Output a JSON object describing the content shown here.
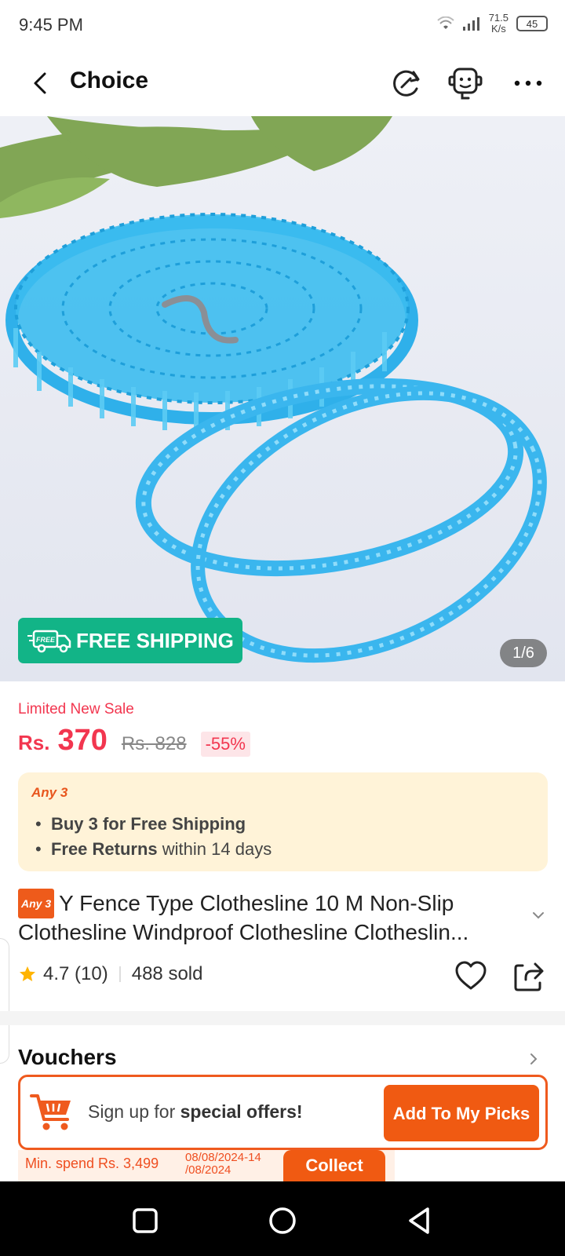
{
  "status_bar": {
    "time": "9:45 PM",
    "net_speed_value": "71.5",
    "net_speed_unit": "K/s",
    "battery": "45"
  },
  "header": {
    "title": "Choice",
    "icons": [
      "back-arrow-icon",
      "refresh-icon",
      "support-bot-icon",
      "more-icon"
    ]
  },
  "gallery": {
    "badge_text": "FREE SHIPPING",
    "badge_icon_text": "FREE",
    "counter": "1/6"
  },
  "price": {
    "sale_label": "Limited New Sale",
    "currency": "Rs.",
    "current": "370",
    "original": "Rs. 828",
    "discount": "-55%"
  },
  "promo": {
    "tag": "Any 3",
    "line1_bold": "Buy 3 for  Free Shipping",
    "line2_bold": "Free Returns",
    "line2_rest": "within 14 days"
  },
  "product": {
    "badge": "Any 3",
    "title_line1": "Y Fence Type Clothesline 10 M Non-Slip",
    "title_line2": "Clothesline Windproof Clothesline Clotheslin..."
  },
  "stats": {
    "rating": "4.7",
    "reviews": "(10)",
    "sold": "488 sold"
  },
  "vouchers": {
    "title": "Vouchers",
    "signup_prefix": "Sign up for",
    "signup_bold": "special offers!",
    "picks_button": "Add To My Picks",
    "min_spend": "Min. spend Rs. 3,499",
    "date_line1": "08/08/2024-14",
    "date_line2": "/08/2024",
    "collect_button": "Collect"
  },
  "colors": {
    "accent_red": "#f2364f",
    "accent_orange": "#f05a12",
    "shipping_green": "#12b487",
    "promo_bg": "#fff3d8"
  }
}
